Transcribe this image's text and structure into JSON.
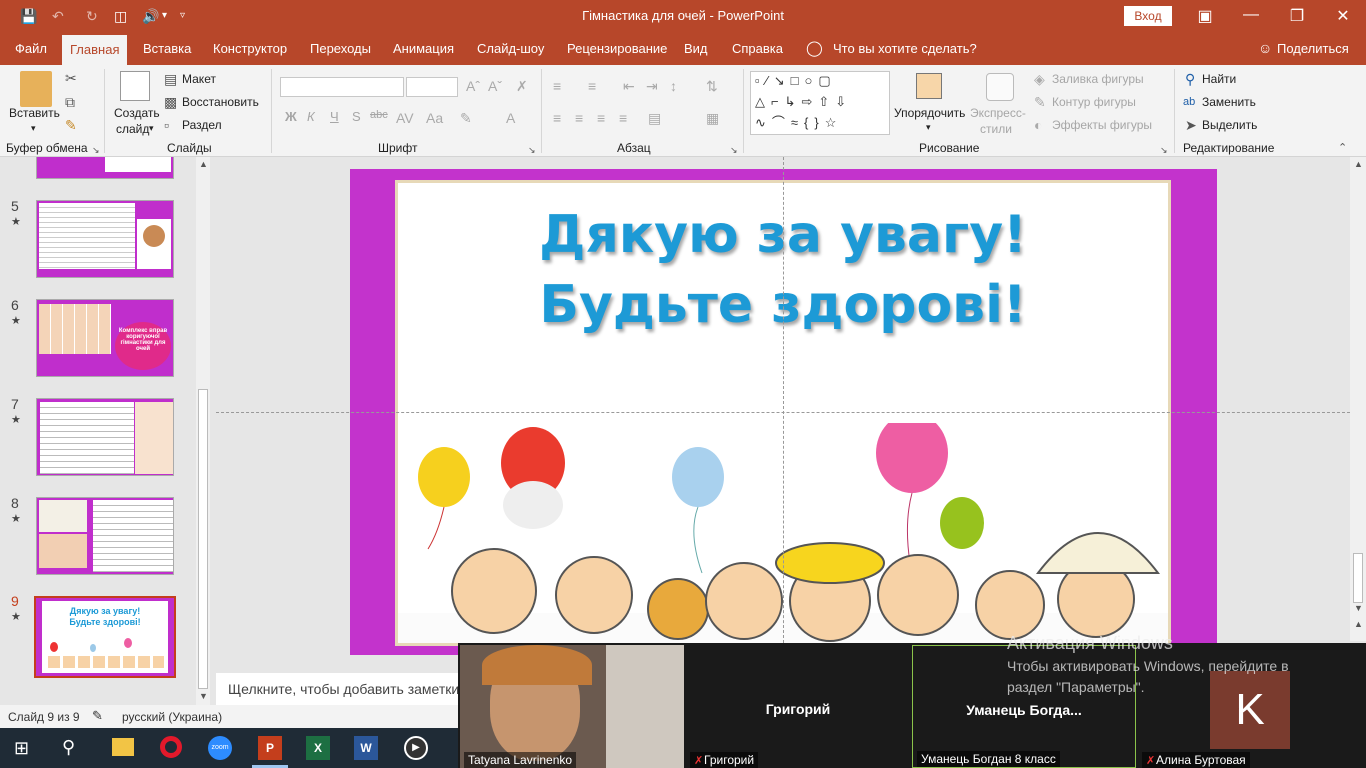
{
  "app": {
    "document_title": "Гімнастика для очей  -  PowerPoint",
    "login_button": "Вход"
  },
  "tabs": [
    {
      "label": "Файл"
    },
    {
      "label": "Главная"
    },
    {
      "label": "Вставка"
    },
    {
      "label": "Конструктор"
    },
    {
      "label": "Переходы"
    },
    {
      "label": "Анимация"
    },
    {
      "label": "Слайд-шоу"
    },
    {
      "label": "Рецензирование"
    },
    {
      "label": "Вид"
    },
    {
      "label": "Справка"
    }
  ],
  "search": {
    "label": "Что вы хотите сделать?"
  },
  "share": {
    "label": "Поделиться"
  },
  "ribbon": {
    "clipboard": {
      "paste": "Вставить",
      "group": "Буфер обмена"
    },
    "slides": {
      "new_slide_line1": "Создать",
      "new_slide_line2": "слайд",
      "layout": "Макет",
      "reset": "Восстановить",
      "section": "Раздел",
      "group": "Слайды"
    },
    "font": {
      "group": "Шрифт",
      "bold": "Ж",
      "italic": "К",
      "underline": "Ч",
      "shadow": "S",
      "strike": "abc"
    },
    "paragraph": {
      "group": "Абзац"
    },
    "drawing": {
      "arrange": "Упорядочить",
      "quick_styles_line1": "Экспресс-",
      "quick_styles_line2": "стили",
      "shape_fill": "Заливка фигуры",
      "shape_outline": "Контур фигуры",
      "shape_effects": "Эффекты фигуры",
      "group": "Рисование"
    },
    "editing": {
      "find": "Найти",
      "replace": "Заменить",
      "select": "Выделить",
      "group": "Редактирование"
    }
  },
  "thumbnails": [
    {
      "num": "5",
      "selected": false
    },
    {
      "num": "6",
      "selected": false,
      "text": "Комплекс вправ коригуючої гімнастики для очей"
    },
    {
      "num": "7",
      "selected": false
    },
    {
      "num": "8",
      "selected": false
    },
    {
      "num": "9",
      "selected": true,
      "text_line1": "Дякую за увагу!",
      "text_line2": "Будьте здорові!"
    }
  ],
  "slide": {
    "title_line1": "Дякую за увагу!",
    "title_line2": "Будьте здорові!"
  },
  "notes": {
    "placeholder": "Щелкните, чтобы добавить заметки"
  },
  "status": {
    "slide_counter": "Слайд 9 из 9",
    "language": "русский (Украина)"
  },
  "zoom": {
    "participants": [
      {
        "label": "Tatyana Lavrinenko",
        "display": ""
      },
      {
        "label": "Григорий",
        "display": "Григорий"
      },
      {
        "label": "Уманець Богдан 8 класс",
        "display": "Уманець  Богда..."
      },
      {
        "label": "Алина Буртовая",
        "display": "K"
      }
    ]
  },
  "activation": {
    "title": "Активация Windows",
    "line1": "Чтобы активировать Windows, перейдите в",
    "line2": "раздел \"Параметры\"."
  },
  "colors": {
    "accent": "#b7472a",
    "slide_border": "#c333cc",
    "title_blue": "#1d9ad6",
    "avatar_k": "#7a3b2e"
  },
  "taskbar_icons": [
    "windows-start-icon",
    "search-icon",
    "file-explorer-icon",
    "opera-icon",
    "zoom-icon",
    "powerpoint-icon",
    "excel-icon",
    "word-icon",
    "media-player-icon"
  ]
}
